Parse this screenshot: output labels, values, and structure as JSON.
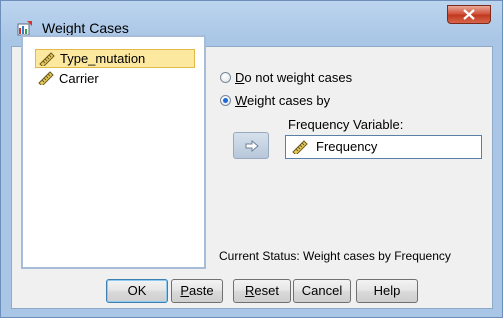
{
  "window": {
    "title": "Weight Cases"
  },
  "variables": [
    {
      "name": "Type_mutation",
      "selected": true,
      "icon": "scale-ruler-icon"
    },
    {
      "name": "Carrier",
      "selected": false,
      "icon": "scale-ruler-icon"
    }
  ],
  "options": {
    "do_not_weight": {
      "mnemonic": "D",
      "rest": "o not weight cases",
      "checked": false
    },
    "weight_by": {
      "mnemonic": "W",
      "rest": "eight cases by",
      "checked": true
    }
  },
  "frequency": {
    "label": "Frequency Variable:",
    "value": "Frequency"
  },
  "status": {
    "text": "Current Status: Weight cases by Frequency"
  },
  "buttons": {
    "ok": "OK",
    "paste_mn": "P",
    "paste_rest": "aste",
    "reset_mn": "R",
    "reset_rest": "eset",
    "cancel": "Cancel",
    "help": "Help"
  },
  "colors": {
    "title_bg": "#bcd4ee",
    "selection": "#fde8a0",
    "close_button": "#c0391f",
    "radio_selected": "#1d6ad6"
  }
}
